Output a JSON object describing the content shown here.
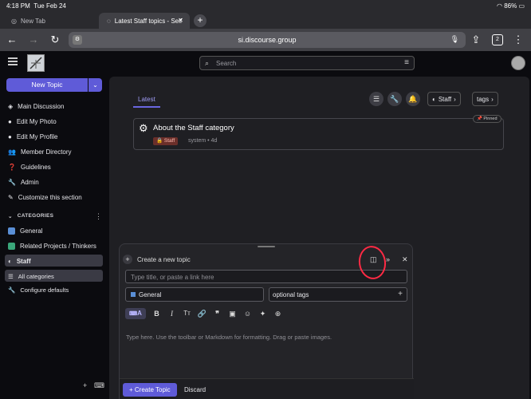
{
  "status": {
    "time": "4:18 PM",
    "date": "Tue Feb 24",
    "battery": "86%"
  },
  "tabs": [
    {
      "label": "New Tab"
    },
    {
      "label": "Latest Staff topics - Self"
    }
  ],
  "url": "si.discourse.group",
  "tab_count": "2",
  "header": {
    "search_placeholder": "Search"
  },
  "sidebar": {
    "new_topic": "New Topic",
    "items": [
      {
        "label": "Main Discussion"
      },
      {
        "label": "Edit My Photo"
      },
      {
        "label": "Edit My Profile"
      },
      {
        "label": "Member Directory"
      },
      {
        "label": "Guidelines"
      },
      {
        "label": "Admin"
      },
      {
        "label": "Customize this section"
      }
    ],
    "categories_header": "CATEGORIES",
    "categories": [
      {
        "label": "General",
        "color": "#5a8fd6"
      },
      {
        "label": "Related Projects / Thinkers",
        "color": "#3aa67a"
      },
      {
        "label": "Staff",
        "color": "#8ab4f8"
      },
      {
        "label": "All categories"
      },
      {
        "label": "Configure defaults"
      }
    ]
  },
  "main": {
    "nav_latest": "Latest",
    "category_chip": "Staff",
    "tags_chip": "tags",
    "topic": {
      "title": "About the Staff category",
      "badge": "Staff",
      "author": "system",
      "sep": "•",
      "age": "4d",
      "pinned": "Pinned"
    }
  },
  "composer": {
    "title": "Create a new topic",
    "title_placeholder": "Type title, or paste a link here",
    "category": "General",
    "tags_placeholder": "optional tags",
    "body_placeholder": "Type here. Use the toolbar or Markdown for formatting. Drag or paste images.",
    "create_button": "Create Topic",
    "discard": "Discard",
    "mode_letter": "A"
  },
  "colors": {
    "accent": "#5f5bd8",
    "annotation": "#ff2a44"
  }
}
